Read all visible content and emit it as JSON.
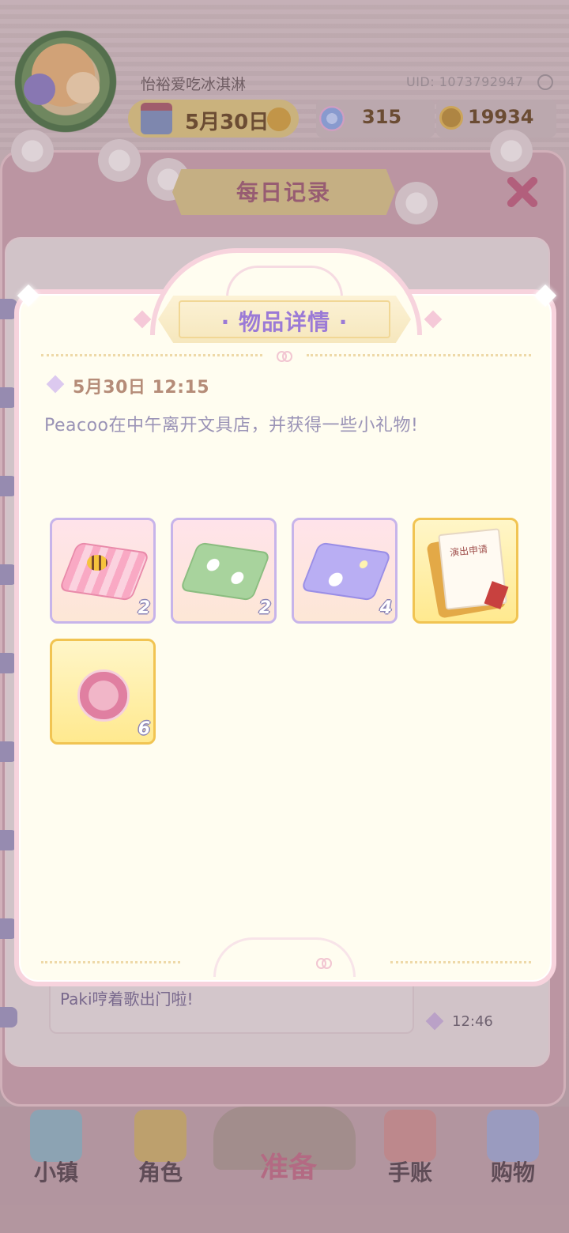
{
  "header": {
    "username": "怡裕爱吃冰淇淋",
    "uid": "UID: 1073792947",
    "date": "5月30日",
    "gems": "315",
    "coins": "19934"
  },
  "daily_record": {
    "title": "每日记录",
    "close_icon": "close-icon",
    "entry_text": "Paki哼着歌出门啦!",
    "entry_time": "12:46"
  },
  "modal": {
    "title": "· 物品详情 ·",
    "datetime": "5月30日 12:15",
    "description": "Peacoo在中午离开文具店，并获得一些小礼物!",
    "items": [
      {
        "name": "pink-bee-cloth",
        "count": "2",
        "rarity": "purple"
      },
      {
        "name": "green-flower-cloth",
        "count": "2",
        "rarity": "purple"
      },
      {
        "name": "purple-cloud-cloth",
        "count": "4",
        "rarity": "purple"
      },
      {
        "name": "performance-application-document",
        "count": "",
        "doc_label": "演出申请",
        "rarity": "gold"
      },
      {
        "name": "pink-badge",
        "count": "6",
        "rarity": "gold"
      }
    ]
  },
  "nav": {
    "town": "小镇",
    "character": "角色",
    "prepare": "准备",
    "journal": "手账",
    "shopping": "购物"
  },
  "colors": {
    "modal_bg": "#fffdf0",
    "modal_border": "#f7d3dd",
    "title_text": "#9b7ad6",
    "purple_slot_border": "#c7b4ea",
    "gold_slot_border": "#f1c452"
  }
}
